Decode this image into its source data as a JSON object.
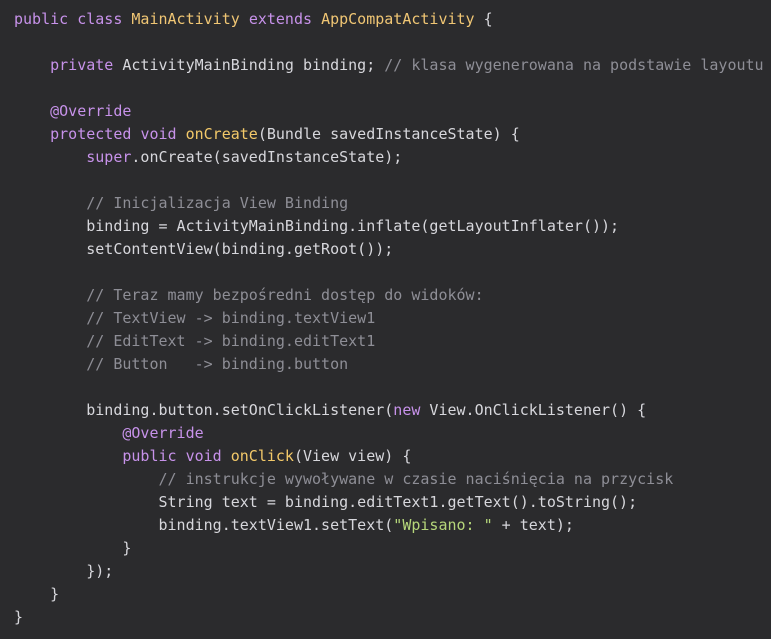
{
  "code": {
    "lines": [
      [
        {
          "t": "public",
          "c": "kw"
        },
        {
          "t": " ",
          "c": "plain"
        },
        {
          "t": "class",
          "c": "kw"
        },
        {
          "t": " ",
          "c": "plain"
        },
        {
          "t": "MainActivity",
          "c": "cls"
        },
        {
          "t": " ",
          "c": "plain"
        },
        {
          "t": "extends",
          "c": "kw"
        },
        {
          "t": " ",
          "c": "plain"
        },
        {
          "t": "AppCompatActivity",
          "c": "cls"
        },
        {
          "t": " {",
          "c": "plain"
        }
      ],
      [],
      [
        {
          "t": "    ",
          "c": "plain"
        },
        {
          "t": "private",
          "c": "kw"
        },
        {
          "t": " ActivityMainBinding binding; ",
          "c": "plain"
        },
        {
          "t": "// klasa wygenerowana na podstawie layoutu",
          "c": "cmt"
        }
      ],
      [],
      [
        {
          "t": "    ",
          "c": "plain"
        },
        {
          "t": "@Override",
          "c": "ann"
        }
      ],
      [
        {
          "t": "    ",
          "c": "plain"
        },
        {
          "t": "protected",
          "c": "kw"
        },
        {
          "t": " ",
          "c": "plain"
        },
        {
          "t": "void",
          "c": "kw"
        },
        {
          "t": " ",
          "c": "plain"
        },
        {
          "t": "onCreate",
          "c": "fn"
        },
        {
          "t": "(Bundle savedInstanceState) {",
          "c": "plain"
        }
      ],
      [
        {
          "t": "        ",
          "c": "plain"
        },
        {
          "t": "super",
          "c": "kw"
        },
        {
          "t": ".onCreate(savedInstanceState);",
          "c": "plain"
        }
      ],
      [],
      [
        {
          "t": "        ",
          "c": "plain"
        },
        {
          "t": "// Inicjalizacja View Binding",
          "c": "cmt"
        }
      ],
      [
        {
          "t": "        binding = ActivityMainBinding.inflate(getLayoutInflater());",
          "c": "plain"
        }
      ],
      [
        {
          "t": "        setContentView(binding.getRoot());",
          "c": "plain"
        }
      ],
      [],
      [
        {
          "t": "        ",
          "c": "plain"
        },
        {
          "t": "// Teraz mamy bezpośredni dostęp do widoków:",
          "c": "cmt"
        }
      ],
      [
        {
          "t": "        ",
          "c": "plain"
        },
        {
          "t": "// TextView -> binding.textView1",
          "c": "cmt"
        }
      ],
      [
        {
          "t": "        ",
          "c": "plain"
        },
        {
          "t": "// EditText -> binding.editText1",
          "c": "cmt"
        }
      ],
      [
        {
          "t": "        ",
          "c": "plain"
        },
        {
          "t": "// Button   -> binding.button",
          "c": "cmt"
        }
      ],
      [],
      [
        {
          "t": "        binding.button.setOnClickListener(",
          "c": "plain"
        },
        {
          "t": "new",
          "c": "kw"
        },
        {
          "t": " View.OnClickListener() {",
          "c": "plain"
        }
      ],
      [
        {
          "t": "            ",
          "c": "plain"
        },
        {
          "t": "@Override",
          "c": "ann"
        }
      ],
      [
        {
          "t": "            ",
          "c": "plain"
        },
        {
          "t": "public",
          "c": "kw"
        },
        {
          "t": " ",
          "c": "plain"
        },
        {
          "t": "void",
          "c": "kw"
        },
        {
          "t": " ",
          "c": "plain"
        },
        {
          "t": "onClick",
          "c": "fn"
        },
        {
          "t": "(View view) {",
          "c": "plain"
        }
      ],
      [
        {
          "t": "                ",
          "c": "plain"
        },
        {
          "t": "// instrukcje wywoływane w czasie naciśnięcia na przycisk",
          "c": "cmt"
        }
      ],
      [
        {
          "t": "                String text = binding.editText1.getText().toString();",
          "c": "plain"
        }
      ],
      [
        {
          "t": "                binding.textView1.setText(",
          "c": "plain"
        },
        {
          "t": "\"Wpisano: \"",
          "c": "str"
        },
        {
          "t": " + text);",
          "c": "plain"
        }
      ],
      [
        {
          "t": "            }",
          "c": "plain"
        }
      ],
      [
        {
          "t": "        });",
          "c": "plain"
        }
      ],
      [
        {
          "t": "    }",
          "c": "plain"
        }
      ],
      [
        {
          "t": "}",
          "c": "plain"
        }
      ]
    ]
  },
  "colors": {
    "background": "#2b2b2d",
    "keyword": "#c792ea",
    "class_name": "#f0c674",
    "method_name": "#f3c969",
    "comment": "#8e8e96",
    "string": "#b5d67a",
    "text": "#d7d7dc"
  }
}
